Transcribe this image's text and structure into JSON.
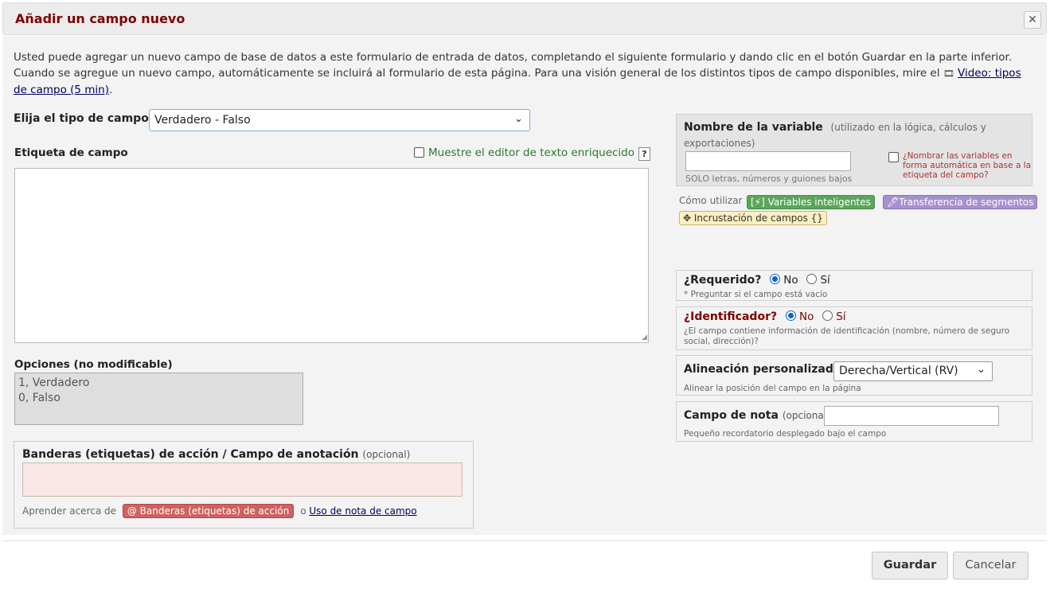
{
  "dialog": {
    "title": "Añadir un campo nuevo",
    "close": "✕"
  },
  "intro": {
    "text": "Usted puede agregar un nuevo campo de base de datos a este formulario de entrada de datos, completando el siguiente formulario y dando clic en el botón Guardar en la parte inferior. Cuando se agregue un nuevo campo, automáticamente se incluirá al formulario de esta página. Para una visión general de los distintos tipos de campo disponibles, mire el ",
    "video_link": "Video: tipos de campo (5 min)",
    "video_icon": "film-icon",
    "end": "."
  },
  "field_type": {
    "label": "Elija el tipo de campo",
    "selected": "Verdadero - Falso"
  },
  "field_label": {
    "title": "Etiqueta de campo",
    "rte_toggle": "Muestre el editor de texto enriquecido",
    "help": "?"
  },
  "choices": {
    "title": "Opciones (no modificable)",
    "lines": [
      "1, Verdadero",
      "0, Falso"
    ]
  },
  "action_tags": {
    "title": "Banderas (etiquetas) de acción / Campo de anotación",
    "optional": "(opcional)",
    "learn": "Aprender acerca de",
    "badge": "@ Banderas (etiquetas) de acción",
    "or": "o",
    "note_link": "Uso de nota de campo"
  },
  "variable": {
    "title": "Nombre de la variable",
    "hint": "(utilizado en la lógica, cálculos y exportaciones)",
    "sub": "SOLO letras, números y guiones bajos",
    "auto_name": "¿Nombrar las variables en forma automática en base a la etiqueta del campo?"
  },
  "howto": {
    "label": "Cómo utilizar",
    "smart_vars": "[⚡] Variables inteligentes",
    "piping": "Transferencia de segmentos",
    "embedding": "Incrustación de campos {}"
  },
  "required": {
    "title": "¿Requerido?",
    "no": "No",
    "yes": "Sí",
    "sub": "* Preguntar si el campo está vacío",
    "value": "No"
  },
  "identifier": {
    "title": "¿Identificador?",
    "no": "No",
    "yes": "Sí",
    "sub": "¿El campo contiene información de identificación (nombre, número de seguro social, dirección)?",
    "value": "No"
  },
  "alignment": {
    "title": "Alineación personalizada",
    "selected": "Derecha/Vertical (RV)",
    "sub": "Alinear la posición del campo en la página"
  },
  "field_note": {
    "title": "Campo de nota",
    "optional": "(opcional)",
    "sub": "Pequeño recordatorio desplegado bajo el campo"
  },
  "buttons": {
    "save": "Guardar",
    "cancel": "Cancelar"
  },
  "colors": {
    "title": "#800000",
    "rte_toggle": "#2b7a2b",
    "action_badge": "#cc6262",
    "smart_vars": "#5aa65a",
    "piping": "#a790cf",
    "embedding": "#fcefc0"
  }
}
